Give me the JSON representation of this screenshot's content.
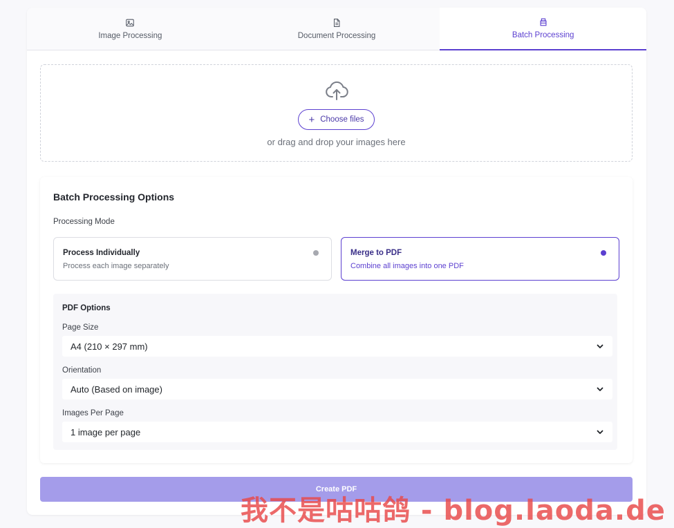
{
  "tabs": [
    {
      "label": "Image Processing",
      "icon": "image-icon",
      "active": false
    },
    {
      "label": "Document Processing",
      "icon": "document-icon",
      "active": false
    },
    {
      "label": "Batch Processing",
      "icon": "layers-icon",
      "active": true
    }
  ],
  "upload": {
    "button_label": "Choose files",
    "hint": "or drag and drop your images here"
  },
  "options": {
    "title": "Batch Processing Options",
    "mode_label": "Processing Mode",
    "modes": [
      {
        "title": "Process Individually",
        "description": "Process each image separately",
        "selected": false
      },
      {
        "title": "Merge to PDF",
        "description": "Combine all images into one PDF",
        "selected": true
      }
    ],
    "pdf": {
      "title": "PDF Options",
      "page_size_label": "Page Size",
      "page_size_value": "A4 (210 × 297 mm)",
      "orientation_label": "Orientation",
      "orientation_value": "Auto (Based on image)",
      "per_page_label": "Images Per Page",
      "per_page_value": "1 image per page"
    }
  },
  "create_button": "Create PDF",
  "watermark": "我不是咕咕鸽 - blog.laoda.de",
  "colors": {
    "accent": "#5b3fd0",
    "button_disabled": "#a49cea",
    "background": "#f8f8fb"
  }
}
